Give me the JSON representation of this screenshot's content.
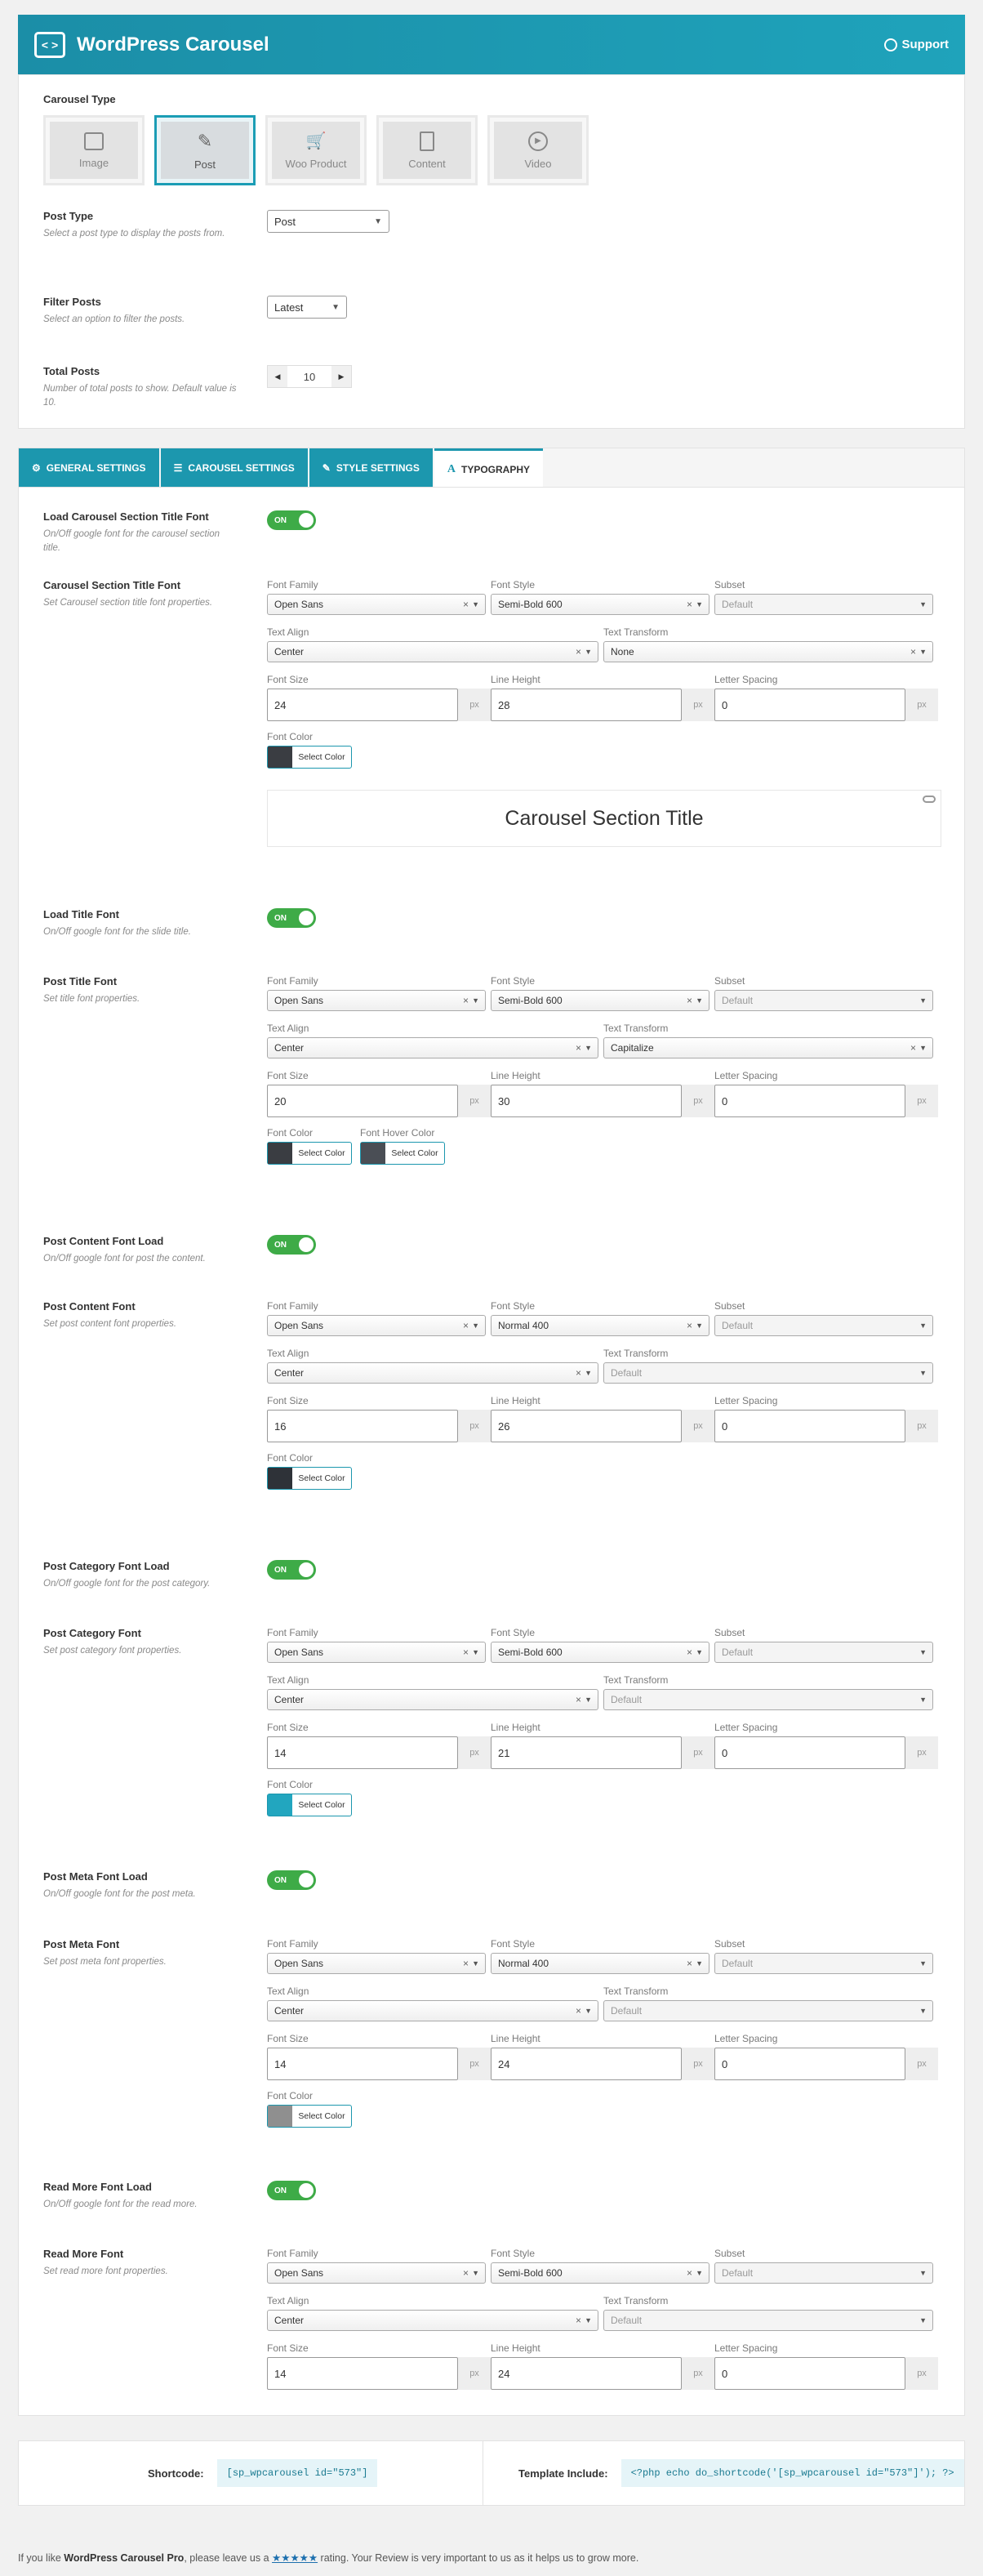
{
  "header": {
    "logo": "< >",
    "title": "WordPress Carousel",
    "support": "Support"
  },
  "general": {
    "carousel_type": {
      "label": "Carousel Type",
      "options": [
        "Image",
        "Post",
        "Woo Product",
        "Content",
        "Video"
      ],
      "selected": "Post"
    },
    "post_type": {
      "label": "Post Type",
      "desc": "Select a post type to display the posts from.",
      "value": "Post"
    },
    "filter_posts": {
      "label": "Filter Posts",
      "desc": "Select an option to filter the posts.",
      "value": "Latest"
    },
    "total_posts": {
      "label": "Total Posts",
      "desc": "Number of total posts to show. Default value is 10.",
      "value": "10"
    }
  },
  "tabs": [
    "GENERAL SETTINGS",
    "CAROUSEL SETTINGS",
    "STYLE SETTINGS",
    "TYPOGRAPHY"
  ],
  "field_labels": {
    "font_family": "Font Family",
    "font_style": "Font Style",
    "subset": "Subset",
    "text_align": "Text Align",
    "text_transform": "Text Transform",
    "font_size": "Font Size",
    "line_height": "Line Height",
    "letter_spacing": "Letter Spacing",
    "font_color": "Font Color",
    "font_hover_color": "Font Hover Color",
    "select_color": "Select Color",
    "px": "px",
    "toggle_on": "ON"
  },
  "typography": [
    {
      "toggle_label": "Load Carousel Section Title Font",
      "toggle_desc": "On/Off google font for the carousel section title.",
      "font_label": "Carousel Section Title Font",
      "font_desc": "Set Carousel section title font properties.",
      "family": "Open Sans",
      "style": "Semi-Bold 600",
      "subset": "Default",
      "align": "Center",
      "transform": "None",
      "size": "24",
      "line": "28",
      "spacing": "0",
      "color": "#3a3d42",
      "preview": "Carousel Section Title"
    },
    {
      "toggle_label": "Load Title Font",
      "toggle_desc": "On/Off google font for the slide title.",
      "font_label": "Post Title Font",
      "font_desc": "Set title font properties.",
      "family": "Open Sans",
      "style": "Semi-Bold 600",
      "subset": "Default",
      "align": "Center",
      "transform": "Capitalize",
      "size": "20",
      "line": "30",
      "spacing": "0",
      "color": "#3a3d42",
      "hover_color": "#4a4e55"
    },
    {
      "toggle_label": "Post Content Font Load",
      "toggle_desc": "On/Off google font for post the content.",
      "font_label": "Post Content Font",
      "font_desc": "Set post content font properties.",
      "family": "Open Sans",
      "style": "Normal 400",
      "subset": "Default",
      "align": "Center",
      "transform": "Default",
      "size": "16",
      "line": "26",
      "spacing": "0",
      "color": "#2e3238"
    },
    {
      "toggle_label": "Post Category Font Load",
      "toggle_desc": "On/Off google font for the post category.",
      "font_label": "Post Category Font",
      "font_desc": "Set post category font properties.",
      "family": "Open Sans",
      "style": "Semi-Bold 600",
      "subset": "Default",
      "align": "Center",
      "transform": "Default",
      "size": "14",
      "line": "21",
      "spacing": "0",
      "color": "#22a6bf"
    },
    {
      "toggle_label": "Post Meta Font Load",
      "toggle_desc": "On/Off google font for the post meta.",
      "font_label": "Post Meta Font",
      "font_desc": "Set post meta font properties.",
      "family": "Open Sans",
      "style": "Normal 400",
      "subset": "Default",
      "align": "Center",
      "transform": "Default",
      "size": "14",
      "line": "24",
      "spacing": "0",
      "color": "#8f8f8f"
    },
    {
      "toggle_label": "Read More Font Load",
      "toggle_desc": "On/Off google font for the read more.",
      "font_label": "Read More Font",
      "font_desc": "Set read more font properties.",
      "family": "Open Sans",
      "style": "Semi-Bold 600",
      "subset": "Default",
      "align": "Center",
      "transform": "Default",
      "size": "14",
      "line": "24",
      "spacing": "0"
    }
  ],
  "shortcode": {
    "label": "Shortcode:",
    "value": "[sp_wpcarousel id=\"573\"]",
    "template_label": "Template Include:",
    "template_value": "<?php echo do_shortcode('[sp_wpcarousel id=\"573\"]'); ?>"
  },
  "footer": {
    "pre": "If you like ",
    "product": "WordPress Carousel Pro",
    "mid": ", please leave us a ",
    "stars": "★★★★★",
    "post": " rating. Your Review is very important to us as it helps us to grow more."
  }
}
